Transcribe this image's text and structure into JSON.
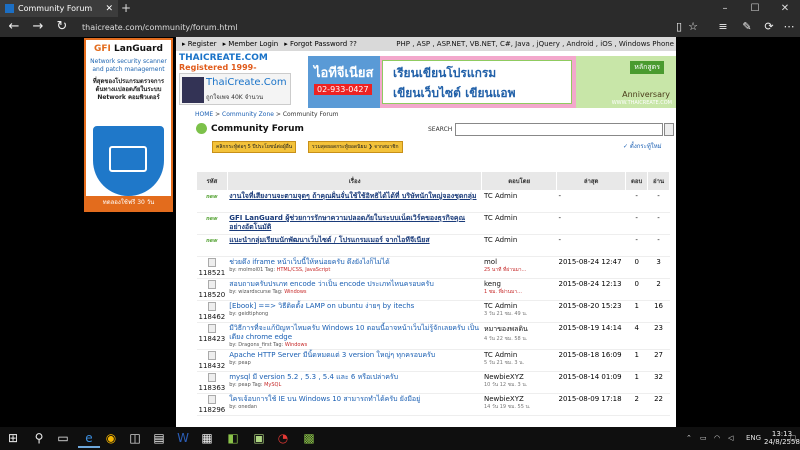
{
  "browser": {
    "tab_title": "Community Forum",
    "tab_close": "✕",
    "new_tab": "+",
    "url": "thaicreate.com/community/forum.html",
    "back": "←",
    "forward": "→",
    "refresh": "↻"
  },
  "ad": {
    "brand_gfi": "GFI",
    "brand_lg": " LanGuard",
    "sub": "Network security scanner and patch management",
    "thai": "ที่สุดของโปรแกรมตรวจการ ต้นทางเเปลอดภัยในระบบ Network คอมพิวเตอร์",
    "button": "ทดลองใช้ฟรี 30 วัน"
  },
  "site": {
    "topnav": {
      "register": "▸ Register",
      "login": "▸ Member Login",
      "forgot": "▸ Forgot Password ??",
      "right": "PHP , ASP , ASP.NET, VB.NET, C#, Java , jQuery , Android , iOS , Windows Phone"
    },
    "header": {
      "brand": "THAICREATE.COM",
      "brand2": "Registered 1999-4-11",
      "logo_title": "ThaiCreate.Com",
      "logo_sub": "ถูกใจเพจ   40K จำนวน",
      "banner_left": "ไอทีจีเนียส",
      "banner_phone": "02-933-0427",
      "banner_mid1": "เรียนเขียนโปรแกรม",
      "banner_mid2": "เขียนเว็บไซต์ เขียนแอพ",
      "banner_tag": "หลักสูตร",
      "banner_ann": "Anniversary",
      "banner_url": "WWW.THAICREATE.COM"
    },
    "breadcrumb": {
      "home": "HOME",
      "zone": "Community Zone",
      "forum": "Community Forum",
      "sep": " > "
    },
    "forum_title": "Community Forum",
    "search_label": "SEARCH",
    "pill1": "คลิกกระทู้ต่อๆ 5 ปีประโยชน์ต่อผู้อื่น",
    "pill2": "รวมสุดยอดกระทู้ยอดนิยม ❯ จากสมาชิก",
    "new_topic": "✓ ตั้งกระทู้ใหม่",
    "columns": {
      "id": "รหัส",
      "topic": "เรื่อง",
      "by": "ตอบโดย",
      "last": "ล่าสุด",
      "rep": "ตอบ",
      "view": "อ่าน"
    },
    "rows": [
      {
        "id": "new",
        "topic": "งานใจที่เสียงานจะตามจุดๆ ถ้าคุณฝั่นจั่นใช้ใช้อิทธิได้ได้ที่ บริษัทนักใหญ่จองชุดกลุ่ม",
        "author": "",
        "tags": "",
        "by": "TC Admin",
        "by_sub": "",
        "last": "-",
        "rep": "-",
        "view": "-",
        "sticky": true
      },
      {
        "id": "new",
        "topic": "GFI LanGuard ผู้ช่วยการรักษาความปลอดภัยในระบบเน็ตเวิร์คของธุรกิจคุณอย่างอัตโนมัติ",
        "author": "",
        "tags": "",
        "by": "TC Admin",
        "by_sub": "",
        "last": "-",
        "rep": "-",
        "view": "-",
        "sticky": true
      },
      {
        "id": "new",
        "topic": "แนะนำกลุ่มเรียนนักพัฒนาเว็บไซต์ / โปรแกรมเมอร์ จากไอทีจีเนียส",
        "author": "",
        "tags": "",
        "by": "TC Admin",
        "by_sub": "",
        "last": "-",
        "rep": "-",
        "view": "-",
        "sticky": true
      },
      {
        "id": "118521",
        "topic": "ช่วยดึง iframe หน้าเว็บนี้ให้หน่อยครับ ดึงยังไงก็ไม่ได้",
        "author": "molmol01",
        "tags": "HTML/CSS, JavaScript",
        "by": "mol",
        "by_sub": "25 นาที ที่ผ่านมา...",
        "last": "2015-08-24 12:47",
        "rep": "0",
        "view": "3",
        "sticky": false
      },
      {
        "id": "118520",
        "topic": "สอบถามครับปรเภท encode ว่าเป็น encode ประเภทไหนครอบครับ",
        "author": "wizardscurse",
        "tags": "Windows",
        "by": "keng",
        "by_sub": "1 ชม. ที่ผ่านมา...",
        "last": "2015-08-24 12:13",
        "rep": "0",
        "view": "2",
        "sticky": false
      },
      {
        "id": "118462",
        "topic": "[Ebook] ==> วิธีติดตั้ง LAMP on ubuntu ง่ายๆ by itechs",
        "author": "geidtiphong",
        "tags": "",
        "by": "TC Admin",
        "by_sub": "3 วัน 21 ชม. 49 น.",
        "last": "2015-08-20 15:23",
        "rep": "1",
        "view": "16",
        "sticky": false
      },
      {
        "id": "118423",
        "topic": "มีวิธีการที่จะแก้ปัญหาไหมครับ Windows 10 ตอนนี้อาจหน้าเว็บไม่รู้จักเลยครับ เป็นเดียง chrome edge",
        "author": "Dragons_first",
        "tags": "Windows",
        "by": "หมาของพลดิน",
        "by_sub": "4 วัน 22 ชม. 58 น.",
        "last": "2015-08-19 14:14",
        "rep": "4",
        "view": "23",
        "sticky": false
      },
      {
        "id": "118432",
        "topic": "Apache HTTP Server มีนิ้ดหมดแต่ 3 version ใหญ่ๆ ทุกครอบครับ",
        "author": "peap",
        "tags": "",
        "by": "TC Admin",
        "by_sub": "5 วัน 21 ชม. 3 น.",
        "last": "2015-08-18 16:09",
        "rep": "1",
        "view": "27",
        "sticky": false
      },
      {
        "id": "118363",
        "topic": "mysql มี version 5.2 , 5.3 , 5.4 และ 6 หรือเปล่าครับ",
        "author": "peap",
        "tags": "MySQL",
        "by": "NewbieXYZ",
        "by_sub": "10 วัน 12 ชม. 3 น.",
        "last": "2015-08-14 01:09",
        "rep": "1",
        "view": "32",
        "sticky": false
      },
      {
        "id": "118296",
        "topic": "ใครเจ้อบการใช้ IE บน Windows 10 สามารถทำได้ครับ ยังมีอยู่",
        "author": "onedan",
        "tags": "",
        "by": "NewbieXYZ",
        "by_sub": "14 วัน 19 ชม. 55 น.",
        "last": "2015-08-09 17:18",
        "rep": "2",
        "view": "22",
        "sticky": false
      }
    ]
  },
  "taskbar": {
    "start": "⊞",
    "search": "⚲",
    "lang": "ENG",
    "time": "13:13",
    "date": "24/8/2558"
  },
  "colors": {
    "accent": "#e36c1d",
    "link": "#1a5fb3",
    "new": "#5aa53a"
  }
}
